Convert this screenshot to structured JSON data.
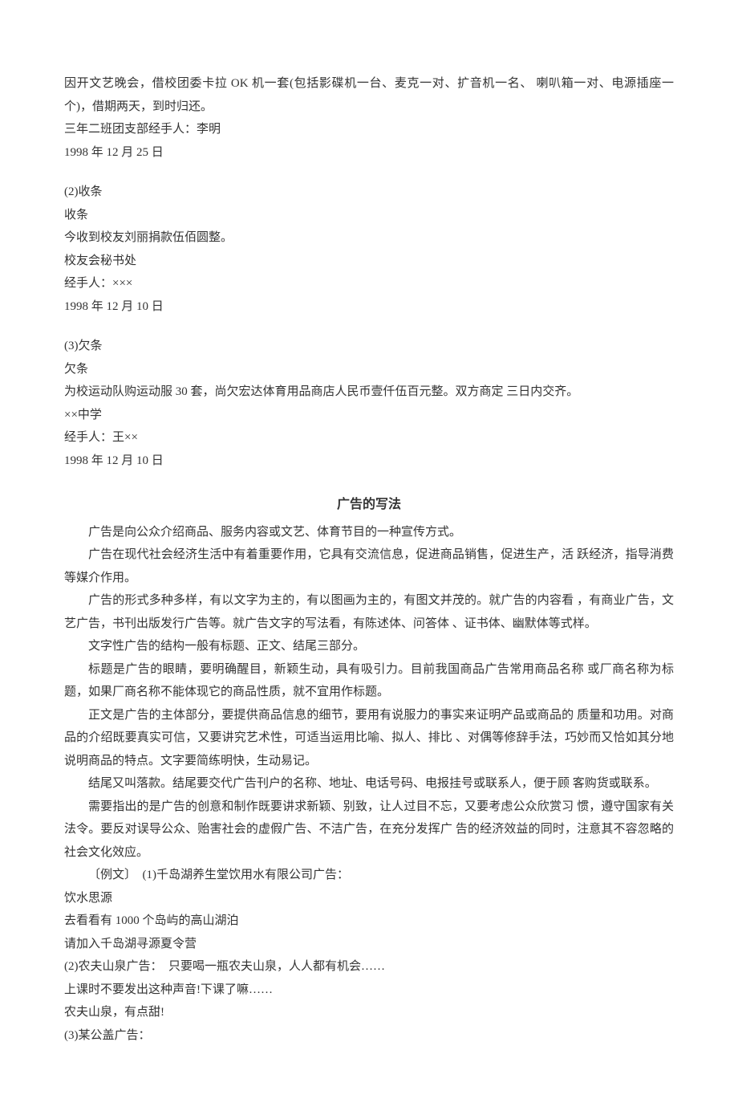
{
  "block1": {
    "p1": "因开文艺晚会，借校团委卡拉 OK 机一套(包括影碟机一台、麦克一对、扩音机一名、 喇叭箱一对、电源插座一个)，借期两天，到时归还。",
    "p2": "三年二班团支部经手人：李明",
    "p3": "1998 年 12 月 25 日"
  },
  "block2": {
    "p1": "(2)收条",
    "p2": "收条",
    "p3": "今收到校友刘丽捐款伍佰圆整。",
    "p4": "校友会秘书处",
    "p5": "经手人：×××",
    "p6": "1998 年 12 月 10 日"
  },
  "block3": {
    "p1": "(3)欠条",
    "p2": "欠条",
    "p3": "为校运动队购运动服 30 套，尚欠宏达体育用品商店人民币壹仟伍百元整。双方商定 三日内交齐。",
    "p4": "××中学",
    "p5": "经手人：王××",
    "p6": "1998 年 12 月 10 日"
  },
  "adSection": {
    "title": "广告的写法",
    "p1": "广告是向公众介绍商品、服务内容或文艺、体育节目的一种宣传方式。",
    "p2": "广告在现代社会经济生活中有着重要作用，它具有交流信息，促进商品销售，促进生产，活 跃经济，指导消费等媒介作用。",
    "p3": "广告的形式多种多样，有以文字为主的，有以图画为主的，有图文并茂的。就广告的内容看 ，有商业广告，文艺广告，书刊出版发行广告等。就广告文字的写法看，有陈述体、问答体 、证书体、幽默体等式样。",
    "p4": "文字性广告的结构一般有标题、正文、结尾三部分。",
    "p5": "标题是广告的眼睛，要明确醒目，新颖生动，具有吸引力。目前我国商品广告常用商品名称 或厂商名称为标题，如果厂商名称不能体现它的商品性质，就不宜用作标题。",
    "p6": "正文是广告的主体部分，要提供商品信息的细节，要用有说服力的事实来证明产品或商品的 质量和功用。对商品的介绍既要真实可信，又要讲究艺术性，可适当运用比喻、拟人、排比 、对偶等修辞手法，巧妙而又恰如其分地说明商品的特点。文字要简练明快，生动易记。",
    "p7": "结尾又叫落款。结尾要交代广告刊户的名称、地址、电话号码、电报挂号或联系人，便于顾 客购货或联系。",
    "p8": "需要指出的是广告的创意和制作既要讲求新颖、别致，让人过目不忘，又要考虑公众欣赏习 惯，遵守国家有关法令。要反对误导公众、贻害社会的虚假广告、不洁广告，在充分发挥广 告的经济效益的同时，注意其不容忽略的社会文化效应。",
    "ex1": "〔例文〕　(1)千岛湖养生堂饮用水有限公司广告：",
    "ex1a": "饮水思源",
    "ex1b": "去看看有 1000 个岛屿的高山湖泊",
    "ex1c": "请加入千岛湖寻源夏令营",
    "ex2": "(2)农夫山泉广告：　只要喝一瓶农夫山泉，人人都有机会……",
    "ex2a": "上课时不要发出这种声音!下课了嘛……",
    "ex2b": "农夫山泉，有点甜!",
    "ex3": "(3)某公盖广告："
  }
}
